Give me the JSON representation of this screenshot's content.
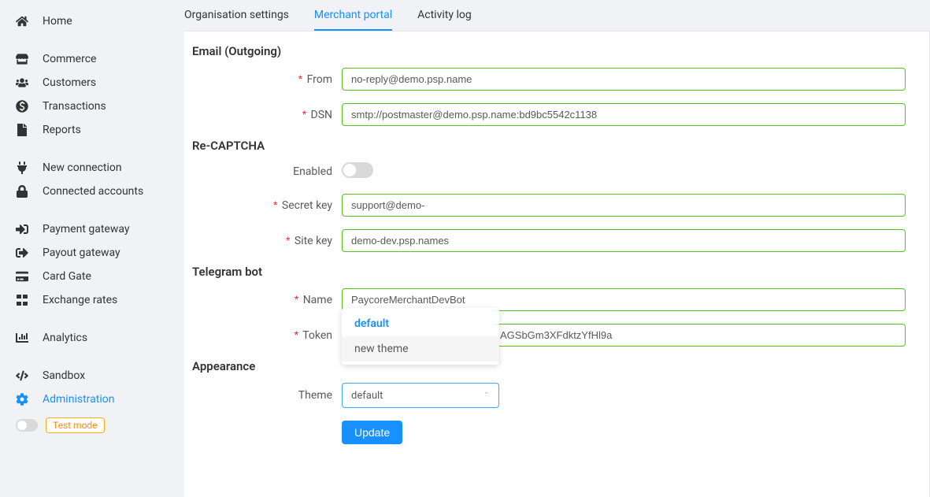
{
  "sidebar": {
    "items": [
      {
        "label": "Home",
        "icon": "home"
      },
      {
        "label": "Commerce",
        "icon": "store"
      },
      {
        "label": "Customers",
        "icon": "users"
      },
      {
        "label": "Transactions",
        "icon": "dollar"
      },
      {
        "label": "Reports",
        "icon": "file"
      },
      {
        "label": "New connection",
        "icon": "plug"
      },
      {
        "label": "Connected accounts",
        "icon": "lock"
      },
      {
        "label": "Payment gateway",
        "icon": "login"
      },
      {
        "label": "Payout gateway",
        "icon": "logout"
      },
      {
        "label": "Card Gate",
        "icon": "card"
      },
      {
        "label": "Exchange rates",
        "icon": "exchange"
      },
      {
        "label": "Analytics",
        "icon": "chart"
      },
      {
        "label": "Sandbox",
        "icon": "code"
      },
      {
        "label": "Administration",
        "icon": "gear",
        "active": true
      }
    ],
    "testmode_label": "Test mode"
  },
  "tabs": [
    {
      "label": "Organisation settings"
    },
    {
      "label": "Merchant portal",
      "active": true
    },
    {
      "label": "Activity log"
    }
  ],
  "sections": {
    "email": {
      "title": "Email (Outgoing)",
      "from_label": "From",
      "from_value": "no-reply@demo.psp.name",
      "dsn_label": "DSN",
      "dsn_value": "smtp://postmaster@demo.psp.name:bd9bc5542c1138"
    },
    "recaptcha": {
      "title": "Re-CAPTCHA",
      "enabled_label": "Enabled",
      "enabled": false,
      "secret_label": "Secret key",
      "secret_value": "support@demo-",
      "site_label": "Site key",
      "site_value": "demo-dev.psp.names"
    },
    "telegram": {
      "title": "Telegram bot",
      "name_label": "Name",
      "name_value": "PaycoreMerchantDevBot",
      "token_label": "Token",
      "token_value": "AGSbGm3XFdktzYfHl9a"
    },
    "appearance": {
      "title": "Appearance",
      "theme_label": "Theme",
      "theme_value": "default",
      "options": [
        "default",
        "new theme"
      ]
    }
  },
  "actions": {
    "update_label": "Update"
  }
}
